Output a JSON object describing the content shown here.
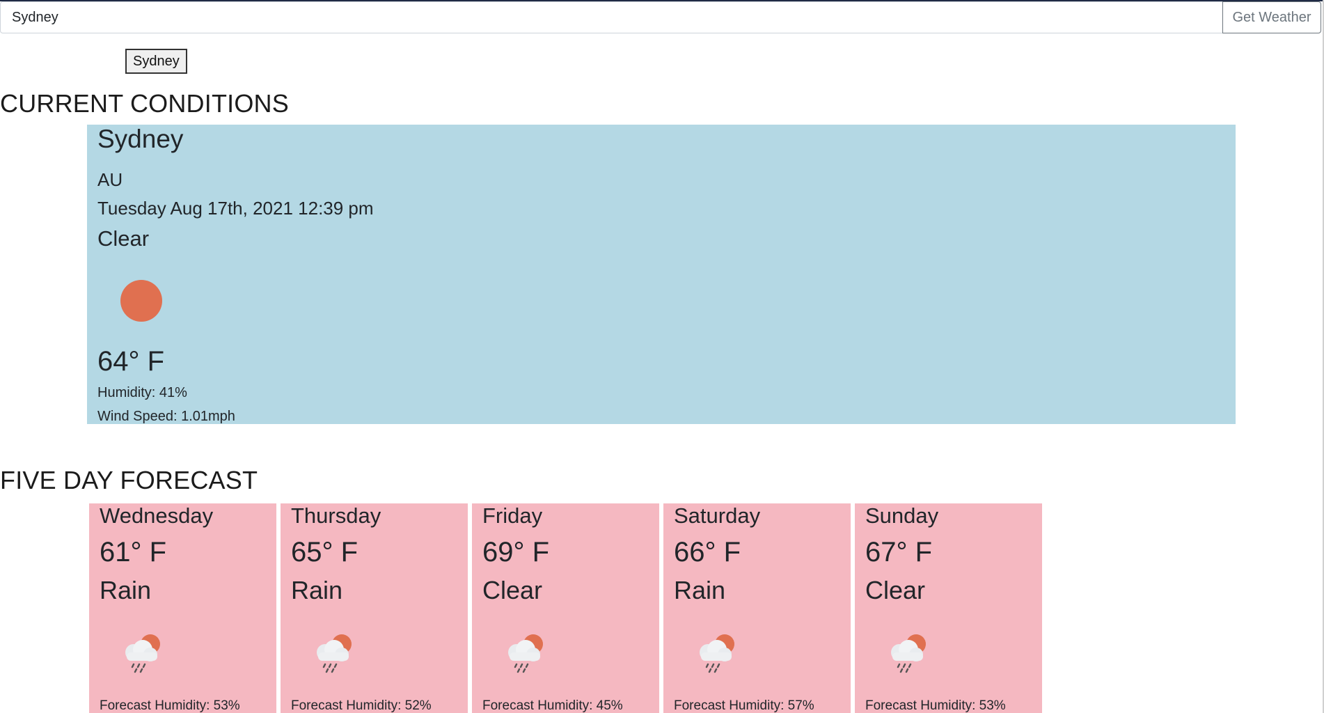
{
  "search": {
    "value": "Sydney",
    "button_label": "Get Weather"
  },
  "history": {
    "items": [
      "Sydney"
    ]
  },
  "current": {
    "heading": "CURRENT CONDITIONS",
    "city": "Sydney",
    "country": "AU",
    "datetime": "Tuesday Aug 17th, 2021 12:39 pm",
    "condition": "Clear",
    "icon": "sun-icon",
    "temp": "64° F",
    "humidity": "Humidity: 41%",
    "wind": "Wind Speed: 1.01mph",
    "card_color": "#b4d8e4"
  },
  "forecast": {
    "heading": "FIVE DAY FORECAST",
    "card_color": "#f5b8c1",
    "days": [
      {
        "day": "Wednesday",
        "temp": "61° F",
        "condition": "Rain",
        "icon": "rain-cloud-icon",
        "humidity": "Forecast Humidity: 53%"
      },
      {
        "day": "Thursday",
        "temp": "65° F",
        "condition": "Rain",
        "icon": "rain-cloud-icon",
        "humidity": "Forecast Humidity: 52%"
      },
      {
        "day": "Friday",
        "temp": "69° F",
        "condition": "Clear",
        "icon": "rain-cloud-icon",
        "humidity": "Forecast Humidity: 45%"
      },
      {
        "day": "Saturday",
        "temp": "66° F",
        "condition": "Rain",
        "icon": "rain-cloud-icon",
        "humidity": "Forecast Humidity: 57%"
      },
      {
        "day": "Sunday",
        "temp": "67° F",
        "condition": "Clear",
        "icon": "rain-cloud-icon",
        "humidity": "Forecast Humidity: 53%"
      }
    ]
  }
}
